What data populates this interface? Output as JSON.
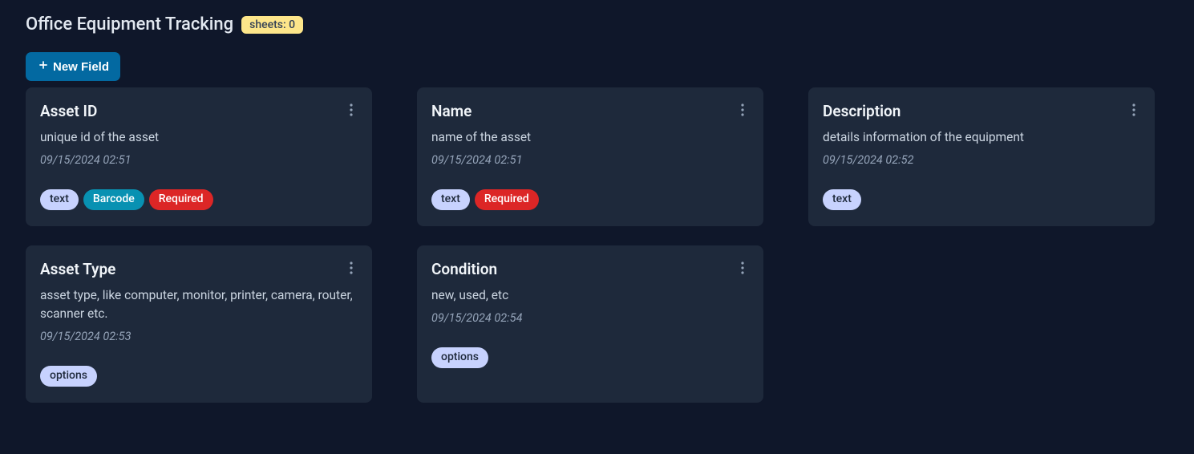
{
  "header": {
    "title": "Office Equipment Tracking",
    "sheets_label": "sheets: 0"
  },
  "toolbar": {
    "new_field_label": "New Field"
  },
  "tag_labels": {
    "text": "text",
    "barcode": "Barcode",
    "required": "Required",
    "options": "options"
  },
  "fields": [
    {
      "title": "Asset ID",
      "description": "unique id of the asset",
      "timestamp": "09/15/2024 02:51",
      "tags": [
        "text",
        "barcode",
        "required"
      ]
    },
    {
      "title": "Name",
      "description": "name of the asset",
      "timestamp": "09/15/2024 02:51",
      "tags": [
        "text",
        "required"
      ]
    },
    {
      "title": "Description",
      "description": "details information of the equipment",
      "timestamp": "09/15/2024 02:52",
      "tags": [
        "text"
      ]
    },
    {
      "title": "Asset Type",
      "description": "asset type, like computer, monitor, printer, camera, router, scanner etc.",
      "timestamp": "09/15/2024 02:53",
      "tags": [
        "options"
      ]
    },
    {
      "title": "Condition",
      "description": "new, used, etc",
      "timestamp": "09/15/2024 02:54",
      "tags": [
        "options"
      ]
    }
  ]
}
